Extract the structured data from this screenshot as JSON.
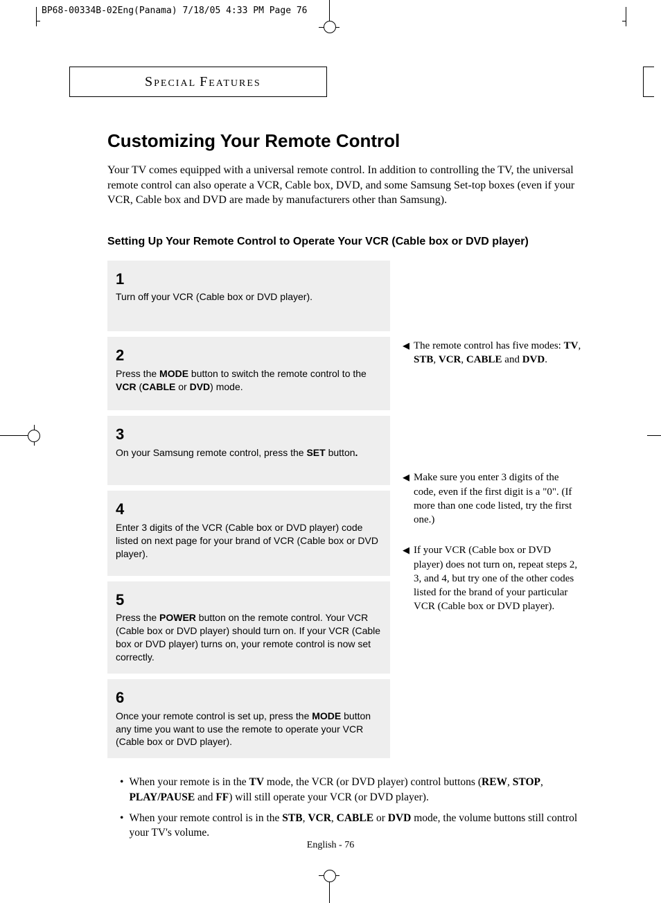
{
  "header_slug": "BP68-00334B-02Eng(Panama)  7/18/05  4:33 PM  Page 76",
  "section_header": "SPECIAL FEATURES",
  "page_title": "Customizing Your Remote Control",
  "intro_text": "Your TV comes equipped with a universal remote control. In addition to controlling the TV, the universal remote control can also operate a VCR, Cable box, DVD, and some Samsung Set-top boxes (even if your VCR, Cable box and DVD are made by manufacturers other than Samsung).",
  "subheading": "Setting Up Your Remote Control to Operate Your VCR (Cable box or DVD player)",
  "steps": [
    {
      "num": "1",
      "text_html": "Turn off your VCR (Cable box or DVD player)."
    },
    {
      "num": "2",
      "text_html": "Press the <b>MODE</b> button to switch the remote control to the <b>VCR</b> (<b>CABLE</b> or <b>DVD</b>) mode."
    },
    {
      "num": "3",
      "text_html": "On your Samsung remote control, press the <b>SET</b> button<b>.</b>"
    },
    {
      "num": "4",
      "text_html": "Enter 3 digits of the VCR (Cable box or DVD player) code listed on next page for your brand of VCR (Cable box or DVD player)."
    },
    {
      "num": "5",
      "text_html": "Press the <b>POWER</b> button on the remote control. Your VCR (Cable box or DVD player) should turn on. If your VCR (Cable box or DVD player) turns on, your remote control is now set correctly."
    },
    {
      "num": "6",
      "text_html": "Once your remote control is set up, press the <b>MODE</b> button any time you want to use the remote to operate your VCR (Cable box or DVD player)."
    }
  ],
  "notes": {
    "n2": "The remote control has five modes: <b>TV</b>, <b>STB</b>, <b>VCR</b>, <b>CABLE</b> and <b>DVD</b>.",
    "n4": "Make sure you enter 3 digits of the code, even if the first digit is a \"0\". (If more than one code listed, try the first one.)",
    "n5": "If your VCR (Cable box or DVD player) does not turn on, repeat steps 2, 3, and 4, but try one of the other codes listed for the brand of your particular VCR (Cable box or DVD player)."
  },
  "bullets": [
    "When your remote is in the <b>TV</b> mode, the VCR (or DVD player) control buttons (<b>REW</b>, <b>STOP</b>, <b>PLAY/PAUSE</b> and <b>FF</b>) will still operate your VCR (or DVD player).",
    "When your remote control is in the <b>STB</b>, <b>VCR</b>, <b>CABLE</b> or <b>DVD</b> mode, the volume buttons still control your TV's volume."
  ],
  "footer": "English - 76"
}
